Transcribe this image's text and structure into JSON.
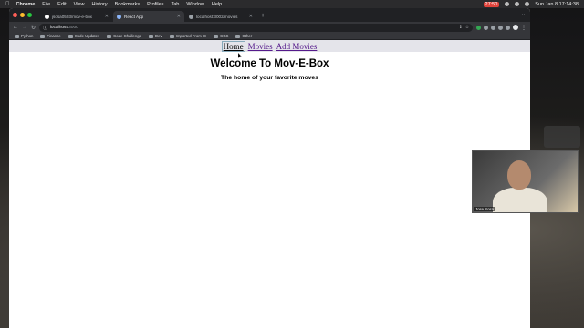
{
  "menubar": {
    "app_name": "Chrome",
    "items": [
      "File",
      "Edit",
      "View",
      "History",
      "Bookmarks",
      "Profiles",
      "Tab",
      "Window",
      "Help"
    ],
    "recording_time": "27:50",
    "datetime": "Sun Jan 8  17:14:38"
  },
  "browser": {
    "tabs": [
      {
        "label": "jsosa0503/mov-e-box",
        "active": false
      },
      {
        "label": "React App",
        "active": true
      },
      {
        "label": "localhost:3002/movies",
        "active": false
      }
    ],
    "new_tab": "+",
    "address": {
      "host": "localhost",
      "port": ":3000"
    },
    "bookmarks": [
      "Python",
      "Finance",
      "Code Updates",
      "Code Challenge",
      "Dev",
      "Imported From IE",
      "CGS",
      "Other"
    ]
  },
  "app": {
    "nav": [
      {
        "label": "Home",
        "active": true
      },
      {
        "label": "Movies",
        "active": false
      },
      {
        "label": "Add Movies",
        "active": false
      }
    ],
    "title": "Welcome To Mov-E-Box",
    "subtitle": "The home of your favorite moves"
  },
  "webcam": {
    "label": "Jose Sosa"
  }
}
